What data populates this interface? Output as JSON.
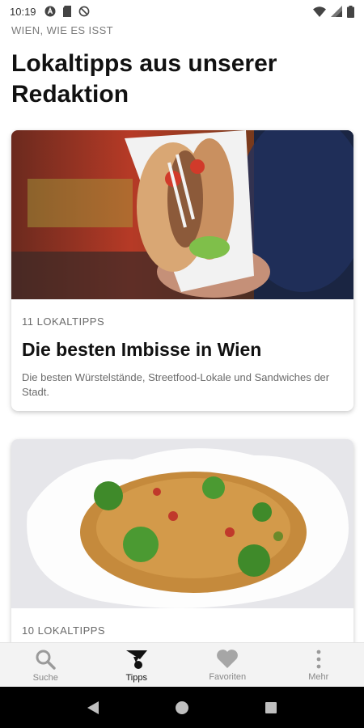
{
  "status_bar": {
    "time": "10:19"
  },
  "header": {
    "kicker": "WIEN, WIE ES ISST",
    "title": "Lokaltipps aus unserer Redaktion"
  },
  "cards": [
    {
      "count": "11 LOKALTIPPS",
      "title": "Die besten Imbisse in Wien",
      "description": "Die besten Würstelstände, Streetfood-Lokale und Sandwiches der Stadt.",
      "image": "kebab-sandwich-photo"
    },
    {
      "count": "10 LOKALTIPPS",
      "title": "",
      "description": "",
      "image": "couscous-salad-photo"
    }
  ],
  "bottom_nav": [
    {
      "label": "Suche",
      "icon": "search-icon"
    },
    {
      "label": "Tipps",
      "icon": "tipps-icon",
      "active": true
    },
    {
      "label": "Favoriten",
      "icon": "heart-icon"
    },
    {
      "label": "Mehr",
      "icon": "more-vertical-icon"
    }
  ],
  "colors": {
    "active": "#111111",
    "inactive": "#9a9a9a",
    "nav_bg": "#f3f3f3"
  }
}
